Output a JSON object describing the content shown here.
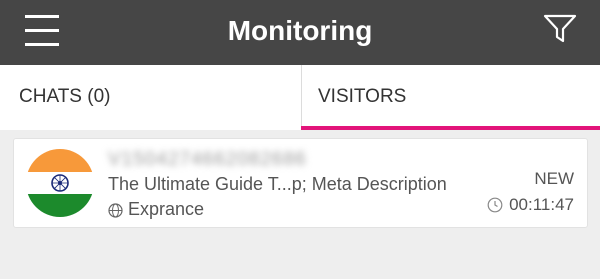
{
  "header": {
    "title": "Monitoring",
    "menu_icon": "hamburger-menu-icon",
    "filter_icon": "filter-funnel-icon"
  },
  "tabs": [
    {
      "label": "CHATS (0)",
      "active": false
    },
    {
      "label": "VISITORS",
      "active": true
    }
  ],
  "visitors": [
    {
      "name": "V1504274662082686",
      "country_flag": "india-flag-icon",
      "page_title": "The Ultimate Guide T...p; Meta Description",
      "location_icon": "globe-icon",
      "location": "Exprance",
      "status": "NEW",
      "time_icon": "clock-icon",
      "duration": "00:11:47"
    }
  ],
  "colors": {
    "header_bg": "#464646",
    "accent": "#e2147a",
    "page_bg": "#eeeeee"
  }
}
